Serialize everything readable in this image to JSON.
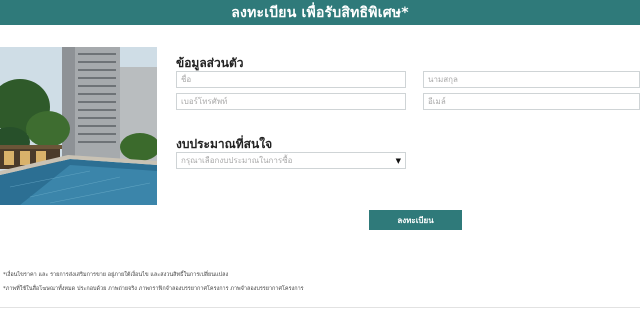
{
  "header": {
    "title": "ลงทะเบียน เพื่อรับสิทธิพิเศษ*"
  },
  "personal": {
    "title": "ข้อมูลส่วนตัว",
    "first_name_placeholder": "ชื่อ",
    "last_name_placeholder": "นามสกุล",
    "phone_placeholder": "เบอร์โทรศัพท์",
    "email_placeholder": "อีเมล์"
  },
  "budget": {
    "title": "งบประมาณที่สนใจ",
    "select_placeholder": "กรุณาเลือกงบประมาณในการซื้อ"
  },
  "submit_label": "ลงทะเบียน",
  "notes": [
    "*เงื่อนไขราคา และ รายการส่งเสริมการขาย อยู่ภายใต้เงื่อนไข และสงวนสิทธิ์ในการเปลี่ยนแปลง",
    "*ภาพที่ใช้ในสื่อโฆษณาทั้งหมด ประกอบด้วย ภาพถ่ายจริง ภาพกราฟิกจำลองบรรยากาศโครงการ ภาพจำลองบรรยากาศโครงการ"
  ],
  "colors": {
    "accent": "#2f7a7a"
  }
}
